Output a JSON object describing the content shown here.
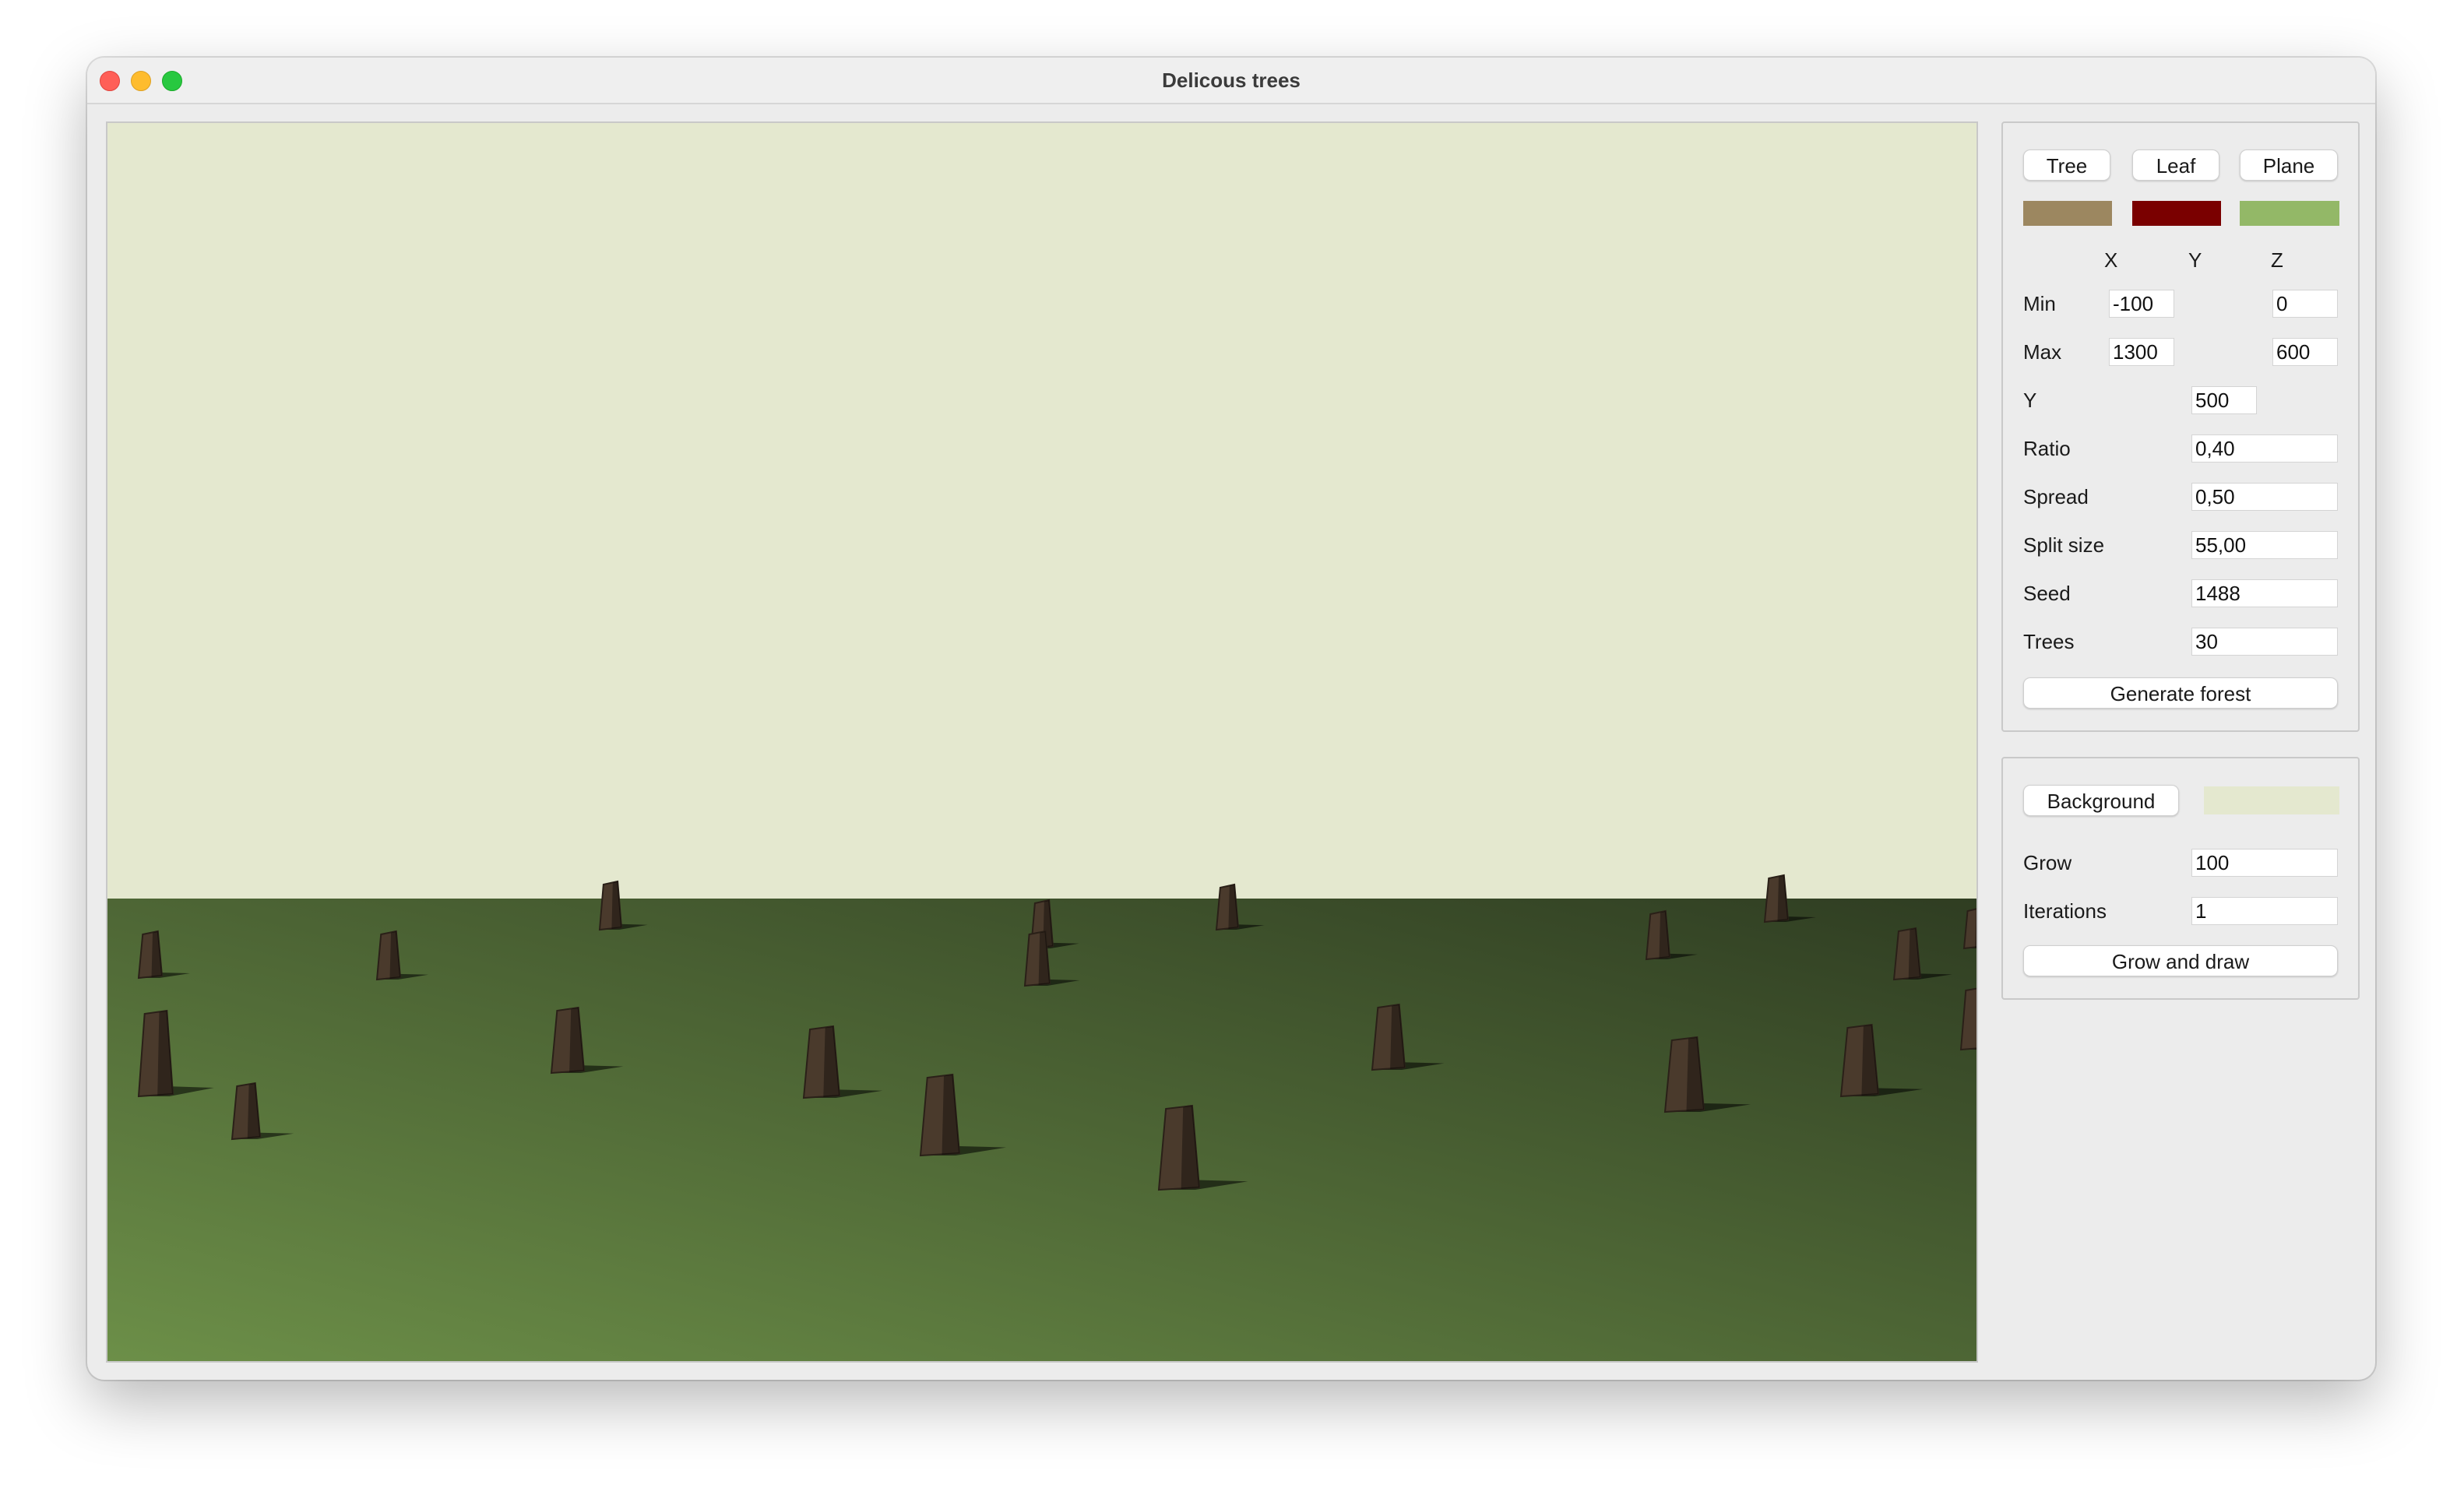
{
  "window": {
    "title": "Delicous trees"
  },
  "colors": {
    "tree": "#9c8760",
    "leaf": "#7a0000",
    "plane": "#93b867",
    "background": "#e4e8cf",
    "ground_light": "#6c8f48",
    "ground_dark": "#2f3d22",
    "trunk": "#4a3a2c"
  },
  "panel_top": {
    "buttons": {
      "tree": "Tree",
      "leaf": "Leaf",
      "plane": "Plane"
    },
    "axis_headers": {
      "x": "X",
      "y": "Y",
      "z": "Z"
    },
    "min": {
      "label": "Min",
      "x": "-100",
      "z": "0"
    },
    "max": {
      "label": "Max",
      "x": "1300",
      "z": "600"
    },
    "y": {
      "label": "Y",
      "value": "500"
    },
    "ratio": {
      "label": "Ratio",
      "value": "0,40"
    },
    "spread": {
      "label": "Spread",
      "value": "0,50"
    },
    "split_size": {
      "label": "Split size",
      "value": "55,00"
    },
    "seed": {
      "label": "Seed",
      "value": "1488"
    },
    "trees": {
      "label": "Trees",
      "value": "30"
    },
    "generate_button": "Generate forest"
  },
  "panel_bottom": {
    "background_button": "Background",
    "grow": {
      "label": "Grow",
      "value": "100"
    },
    "iterations": {
      "label": "Iterations",
      "value": "1"
    },
    "grow_draw_button": "Grow and draw"
  }
}
